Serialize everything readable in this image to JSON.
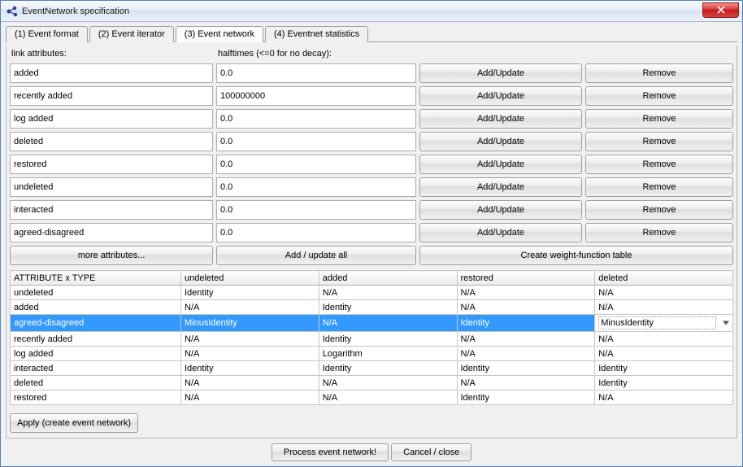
{
  "window": {
    "title": "EventNetwork specification"
  },
  "tabs": [
    {
      "label": "(1) Event format"
    },
    {
      "label": "(2) Event iterator"
    },
    {
      "label": "(3) Event network"
    },
    {
      "label": "(4) Eventnet statistics"
    }
  ],
  "active_tab": 2,
  "section_headers": {
    "link_attributes": "link attributes:",
    "halftimes": "halftimes (<=0 for no decay):"
  },
  "attributes": [
    {
      "name": "added",
      "halftime": "0.0"
    },
    {
      "name": "recently added",
      "halftime": "100000000"
    },
    {
      "name": "log added",
      "halftime": "0.0"
    },
    {
      "name": "deleted",
      "halftime": "0.0"
    },
    {
      "name": "restored",
      "halftime": "0.0"
    },
    {
      "name": "undeleted",
      "halftime": "0.0"
    },
    {
      "name": "interacted",
      "halftime": "0.0"
    },
    {
      "name": "agreed-disagreed",
      "halftime": "0.0"
    }
  ],
  "buttons": {
    "add_update": "Add/Update",
    "remove": "Remove",
    "more_attributes": "more attributes...",
    "add_update_all": "Add / update all",
    "create_weight_table": "Create weight-function table",
    "apply": "Apply (create event network)",
    "process": "Process event network!",
    "cancel": "Cancel / close"
  },
  "cross_table": {
    "corner": "ATTRIBUTE x TYPE",
    "cols": [
      "undeleted",
      "added",
      "restored",
      "deleted"
    ],
    "rows": [
      {
        "name": "undeleted",
        "cells": [
          "Identity",
          "N/A",
          "N/A",
          "N/A"
        ]
      },
      {
        "name": "added",
        "cells": [
          "N/A",
          "Identity",
          "N/A",
          "N/A"
        ]
      },
      {
        "name": "agreed-disagreed",
        "cells": [
          "MinusIdentity",
          "N/A",
          "Identity",
          "MinusIdentity"
        ],
        "selected": true,
        "combo_col": 3
      },
      {
        "name": "recently added",
        "cells": [
          "N/A",
          "Identity",
          "N/A",
          "N/A"
        ]
      },
      {
        "name": "log added",
        "cells": [
          "N/A",
          "Logarithm",
          "N/A",
          "N/A"
        ]
      },
      {
        "name": "interacted",
        "cells": [
          "Identity",
          "Identity",
          "Identity",
          "Identity"
        ]
      },
      {
        "name": "deleted",
        "cells": [
          "N/A",
          "N/A",
          "N/A",
          "Identity"
        ]
      },
      {
        "name": "restored",
        "cells": [
          "N/A",
          "N/A",
          "Identity",
          "N/A"
        ]
      }
    ]
  }
}
